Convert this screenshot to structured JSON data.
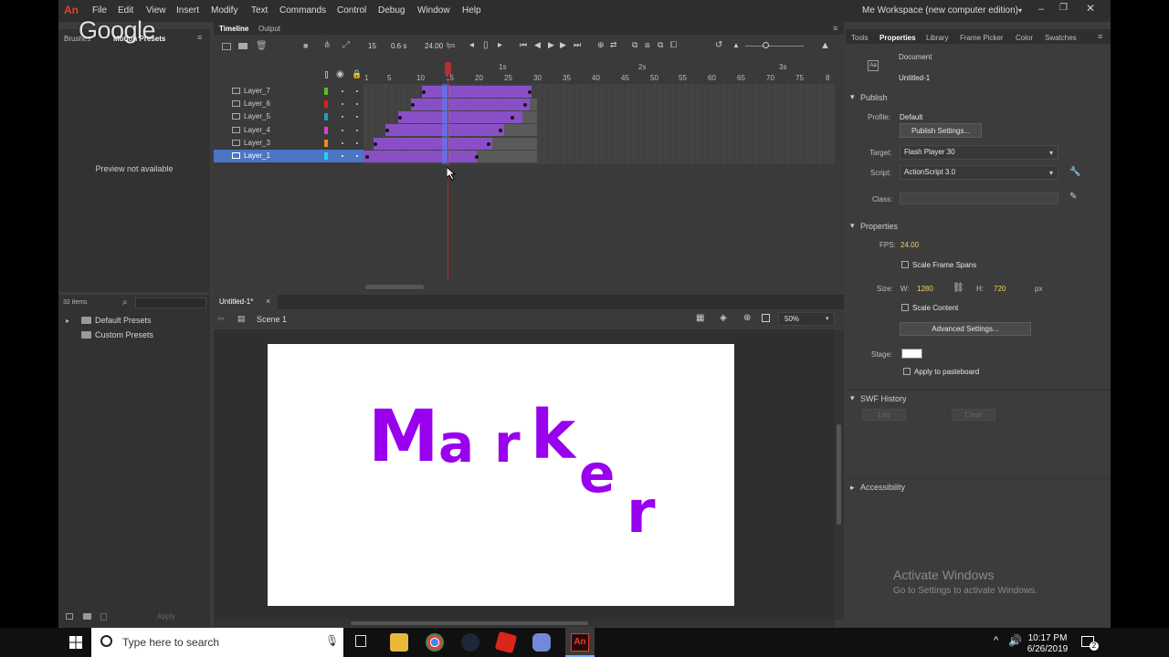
{
  "overlay": {
    "google": "Google"
  },
  "menubar": {
    "logo": "An",
    "items": [
      "File",
      "Edit",
      "View",
      "Insert",
      "Modify",
      "Text",
      "Commands",
      "Control",
      "Debug",
      "Window",
      "Help"
    ],
    "workspace": "Me Workspace (new computer edition)"
  },
  "left_panel": {
    "tabs": [
      "Brushes",
      "Motion Presets"
    ],
    "preview": "Preview not available",
    "items_count": "32 items",
    "folders": [
      "Default Presets",
      "Custom Presets"
    ],
    "apply": "Apply"
  },
  "timeline": {
    "tabs": [
      "Timeline",
      "Output"
    ],
    "current_frame": "15",
    "time": "0.6 s",
    "fps": "24.00",
    "fps_unit": "fps",
    "second_markers": [
      "1s",
      "2s",
      "3s"
    ],
    "frame_numbers": [
      "1",
      "5",
      "10",
      "15",
      "20",
      "25",
      "30",
      "35",
      "40",
      "45",
      "50",
      "55",
      "60",
      "65",
      "70",
      "75",
      "8"
    ],
    "layers": [
      {
        "name": "Layer_7",
        "color": "#5bbf1b"
      },
      {
        "name": "Layer_6",
        "color": "#e0201b"
      },
      {
        "name": "Layer_5",
        "color": "#1b9fbf"
      },
      {
        "name": "Layer_4",
        "color": "#e03fd0"
      },
      {
        "name": "Layer_3",
        "color": "#f08a1b"
      },
      {
        "name": "Layer_1",
        "color": "#1bd7f0"
      }
    ]
  },
  "document_tab": {
    "title": "Untitled-1*",
    "scene": "Scene 1",
    "zoom": "50%"
  },
  "stage": {
    "text": "Marker",
    "bg": "#ffffff",
    "text_color": "#9900ee"
  },
  "properties": {
    "tabs": [
      "Tools",
      "Properties",
      "Library",
      "Frame Picker",
      "Color",
      "Swatches"
    ],
    "doc_label": "Document",
    "doc_name": "Untitled-1",
    "publish_header": "Publish",
    "profile_label": "Profile:",
    "profile_value": "Default",
    "publish_settings": "Publish Settings...",
    "target_label": "Target:",
    "target_value": "Flash Player 30",
    "script_label": "Script:",
    "script_value": "ActionScript 3.0",
    "class_label": "Class:",
    "props_header": "Properties",
    "fps_label": "FPS:",
    "fps_value": "24.00",
    "scale_frame_spans": "Scale Frame Spans",
    "size_label": "Size:",
    "w_label": "W:",
    "w_value": "1280",
    "h_label": "H:",
    "h_value": "720",
    "px": "px",
    "scale_content": "Scale Content",
    "advanced": "Advanced Settings...",
    "stage_label": "Stage:",
    "pasteboard": "Apply to pasteboard",
    "swf_header": "SWF History",
    "log": "Log",
    "clear": "Clear",
    "accessibility": "Accessibility"
  },
  "watermark": {
    "line1": "Activate Windows",
    "line2": "Go to Settings to activate Windows."
  },
  "taskbar": {
    "search_placeholder": "Type here to search",
    "time": "10:17 PM",
    "date": "6/26/2019",
    "notif_count": "2"
  }
}
